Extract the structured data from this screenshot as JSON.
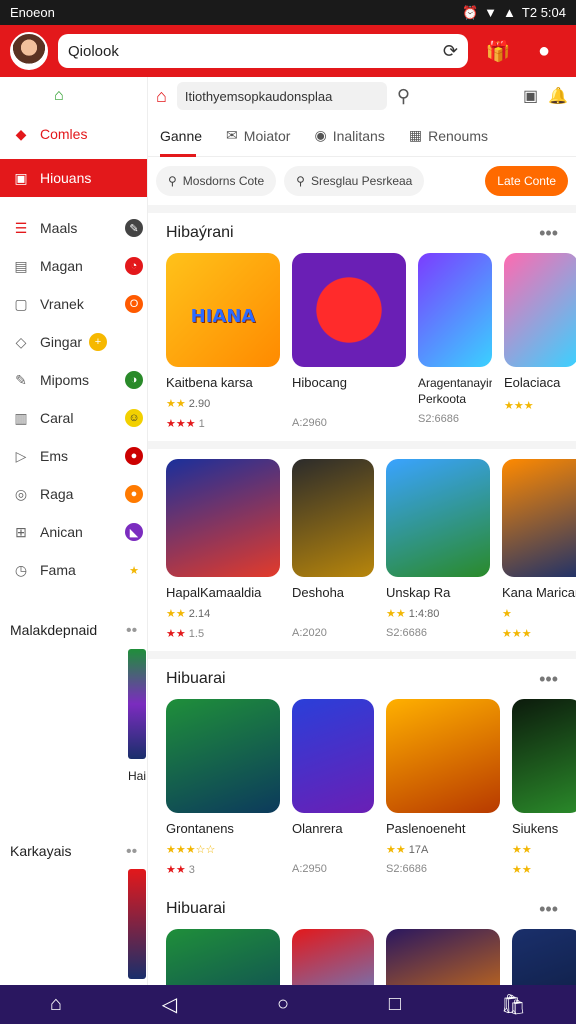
{
  "status": {
    "carrier": "Enoeon",
    "time": "Т2 5:04"
  },
  "appbar": {
    "search_value": "Qiolook"
  },
  "sidebar": {
    "items": [
      {
        "label": "Comles"
      },
      {
        "label": "Hiouans"
      },
      {
        "label": "Maals"
      },
      {
        "label": "Magan"
      },
      {
        "label": "Vranek"
      },
      {
        "label": "Gingar"
      },
      {
        "label": "Mipoms"
      },
      {
        "label": "Caral"
      },
      {
        "label": "Ems"
      },
      {
        "label": "Raga"
      },
      {
        "label": "Anican"
      },
      {
        "label": "Fama"
      }
    ],
    "section1": "Malakdepnaid",
    "section2": "Karkayais",
    "side_fragment": "Hai"
  },
  "main": {
    "addr_value": "Itiothyemsopkaudonsplaa",
    "tabs": [
      "Ganne",
      "Moiator",
      "Inalitans",
      "Renoums"
    ],
    "filters": {
      "f1": "Mosdorns Cote",
      "f2": "Sresglau Pesrkeaa",
      "cta": "Late Conte"
    },
    "sections": [
      {
        "title": "Hibaýrani",
        "cards": [
          {
            "name": "Kaitbena karsa",
            "rating": "2.90",
            "sub": "1"
          },
          {
            "name": "Hibocang",
            "rating": "",
            "sub": "A:2960"
          },
          {
            "name": "Aragentanayirikin Perkoota",
            "rating": "",
            "sub": "S2:6686"
          },
          {
            "name": "Eolaciaca",
            "rating": "",
            "sub": ""
          }
        ]
      },
      {
        "title": "",
        "cards": [
          {
            "name": "HapalKamaaldia",
            "rating": "2.14",
            "sub": "1.5"
          },
          {
            "name": "Deshoha",
            "rating": "",
            "sub": "A:2020"
          },
          {
            "name": "Unskap Ra",
            "rating": "1:4:80",
            "sub": "S2:6686"
          },
          {
            "name": "Kana Marican",
            "rating": "",
            "sub": ""
          }
        ]
      },
      {
        "title": "Hibuarai",
        "cards": [
          {
            "name": "Grontanens",
            "rating": "",
            "sub": "3"
          },
          {
            "name": "Olanrera",
            "rating": "",
            "sub": "A:2950"
          },
          {
            "name": "Paslenoeneht",
            "rating": "17A",
            "sub": "S2:6686"
          },
          {
            "name": "Siukens",
            "rating": "",
            "sub": ""
          }
        ]
      },
      {
        "title": "Hibuarai",
        "cards": []
      }
    ]
  }
}
